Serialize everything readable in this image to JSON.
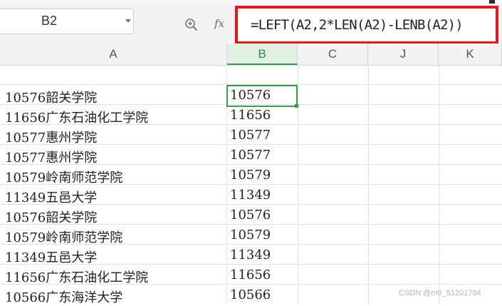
{
  "name_box": {
    "value": "B2"
  },
  "formula_bar": {
    "fx_label": "fx",
    "formula": "=LEFT(A2,2*LEN(A2)-LENB(A2))"
  },
  "columns": [
    {
      "label": "A",
      "selected": false
    },
    {
      "label": "B",
      "selected": true
    },
    {
      "label": "C",
      "selected": false
    },
    {
      "label": "J",
      "selected": false
    },
    {
      "label": "K",
      "selected": false
    }
  ],
  "rows": [
    {
      "a": "",
      "b": ""
    },
    {
      "a": "10576韶关学院",
      "b": "10576"
    },
    {
      "a": "11656广东石油化工学院",
      "b": "11656"
    },
    {
      "a": "10577惠州学院",
      "b": "10577"
    },
    {
      "a": "10577惠州学院",
      "b": "10577"
    },
    {
      "a": "10579岭南师范学院",
      "b": "10579"
    },
    {
      "a": "11349五邑大学",
      "b": "11349"
    },
    {
      "a": "10576韶关学院",
      "b": "10576"
    },
    {
      "a": "10579岭南师范学院",
      "b": "10579"
    },
    {
      "a": "11349五邑大学",
      "b": "11349"
    },
    {
      "a": "11656广东石油化工学院",
      "b": "11656"
    },
    {
      "a": "10566广东海洋大学",
      "b": "10566"
    }
  ],
  "watermark": "CSDN @m0_51201784",
  "colors": {
    "accent": "#3a9a4a",
    "highlight_border": "#e0191f"
  }
}
